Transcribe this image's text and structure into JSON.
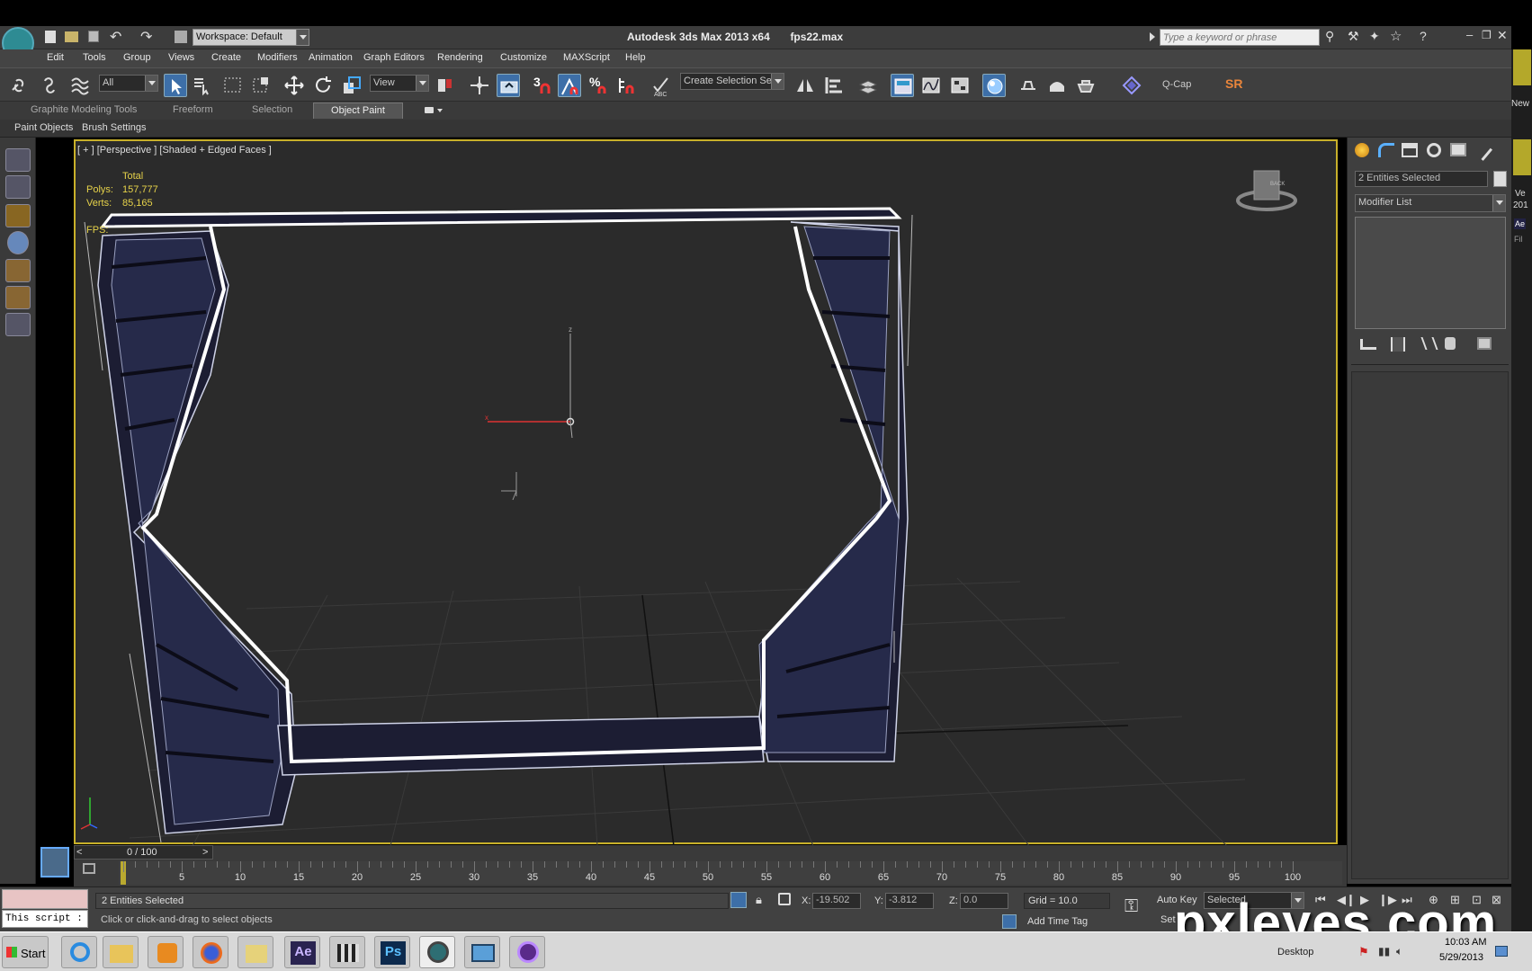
{
  "window": {
    "title": "Autodesk 3ds Max  2013 x64",
    "filename": "fps22.max",
    "workspace": "Workspace: Default",
    "search_placeholder": "Type a keyword or phrase"
  },
  "menu": [
    "Edit",
    "Tools",
    "Group",
    "Views",
    "Create",
    "Modifiers",
    "Animation",
    "Graph Editors",
    "Rendering",
    "Customize",
    "MAXScript",
    "Help"
  ],
  "toolbar": {
    "filter_value": "All",
    "ref_coord_value": "View",
    "snap_3_label": "3",
    "named_selection": "Create Selection Se",
    "qcap_label": "Q-Cap",
    "sr_label": "SR"
  },
  "ribbon": {
    "tabs": [
      "Graphite Modeling Tools",
      "Freeform",
      "Selection",
      "Object Paint"
    ],
    "active_tab": "Object Paint",
    "subtabs": [
      "Paint Objects",
      "Brush Settings"
    ]
  },
  "viewport": {
    "label": "[ + ] [Perspective ] [Shaded + Edged Faces ]",
    "stats_header": "Total",
    "polys_label": "Polys:",
    "polys_value": "157,777",
    "verts_label": "Verts:",
    "verts_value": "85,165",
    "fps_label": "FPS:",
    "viewcube_label": "BACK"
  },
  "command_panel": {
    "selection_name": "2 Entities Selected",
    "modifier_list": "Modifier List"
  },
  "timeline": {
    "frame_counter": "0 / 100",
    "ticks": [
      "5",
      "10",
      "15",
      "20",
      "25",
      "30",
      "35",
      "40",
      "45",
      "50",
      "55",
      "60",
      "65",
      "70",
      "75",
      "80",
      "85",
      "90",
      "95",
      "100"
    ]
  },
  "status": {
    "maxscript_text": "This script :",
    "selected_text": "2 Entities Selected",
    "prompt_text": "Click or click-and-drag to select objects",
    "x_label": "X:",
    "x_value": "-19.502",
    "y_label": "Y:",
    "y_value": "-3.812",
    "z_label": "Z:",
    "z_value": "0.0",
    "grid": "Grid = 10.0",
    "add_time_tag": "Add Time Tag",
    "auto_key": "Auto Key",
    "set_key": "Set",
    "key_filter": "Selected"
  },
  "taskbar": {
    "start": "Start",
    "desktop": "Desktop",
    "time": "10:03 AM",
    "date": "5/29/2013"
  },
  "watermark": "pxleyes.com",
  "right_edge": {
    "new_label": "New",
    "ve_label": "Ve",
    "yr_label": "201",
    "ae_label": "Ae",
    "fil_label": "Fil"
  },
  "colors": {
    "selection_yellow": "#c8b02a",
    "active_blue": "#3d6fa8",
    "viewport_bg": "#2b2b2b",
    "mesh_dark": "#1c1d33"
  }
}
